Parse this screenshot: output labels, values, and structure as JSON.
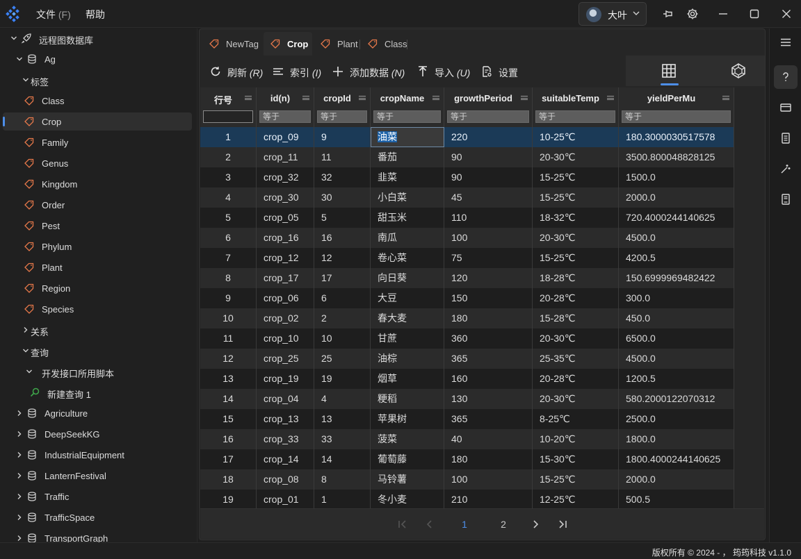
{
  "titlebar": {
    "menu": [
      {
        "label": "文件",
        "accel": "(F)"
      },
      {
        "label": "帮助",
        "accel": ""
      }
    ],
    "user": {
      "name": "大叶"
    }
  },
  "sidebar": {
    "items": [
      {
        "label": "远程图数据库",
        "icon": "rocket-icon",
        "chevron": "down",
        "level": 0
      },
      {
        "label": "Ag",
        "icon": "database-icon",
        "chevron": "down",
        "level": 1
      },
      {
        "label": "标签",
        "icon": "",
        "chevron": "down",
        "level": 2
      },
      {
        "label": "Class",
        "icon": "tag-icon",
        "chevron": "",
        "level": 3
      },
      {
        "label": "Crop",
        "icon": "tag-icon",
        "chevron": "",
        "level": 3,
        "selected": true
      },
      {
        "label": "Family",
        "icon": "tag-icon",
        "chevron": "",
        "level": 3
      },
      {
        "label": "Genus",
        "icon": "tag-icon",
        "chevron": "",
        "level": 3
      },
      {
        "label": "Kingdom",
        "icon": "tag-icon",
        "chevron": "",
        "level": 3
      },
      {
        "label": "Order",
        "icon": "tag-icon",
        "chevron": "",
        "level": 3
      },
      {
        "label": "Pest",
        "icon": "tag-icon",
        "chevron": "",
        "level": 3
      },
      {
        "label": "Phylum",
        "icon": "tag-icon",
        "chevron": "",
        "level": 3
      },
      {
        "label": "Plant",
        "icon": "tag-icon",
        "chevron": "",
        "level": 3
      },
      {
        "label": "Region",
        "icon": "tag-icon",
        "chevron": "",
        "level": 3
      },
      {
        "label": "Species",
        "icon": "tag-icon",
        "chevron": "",
        "level": 3
      },
      {
        "label": "关系",
        "icon": "",
        "chevron": "right",
        "level": 2
      },
      {
        "label": "查询",
        "icon": "",
        "chevron": "down",
        "level": 2
      },
      {
        "label": "开发接口所用脚本",
        "icon": "",
        "chevron": "down",
        "level": 3
      },
      {
        "label": "新建查询 1",
        "icon": "search-icon",
        "chevron": "",
        "level": 4
      },
      {
        "label": "Agriculture",
        "icon": "database-icon",
        "chevron": "right",
        "level": 1
      },
      {
        "label": "DeepSeekKG",
        "icon": "database-icon",
        "chevron": "right",
        "level": 1
      },
      {
        "label": "IndustrialEquipment",
        "icon": "database-icon",
        "chevron": "right",
        "level": 1
      },
      {
        "label": "LanternFestival",
        "icon": "database-icon",
        "chevron": "right",
        "level": 1
      },
      {
        "label": "Traffic",
        "icon": "database-icon",
        "chevron": "right",
        "level": 1
      },
      {
        "label": "TrafficSpace",
        "icon": "database-icon",
        "chevron": "right",
        "level": 1
      },
      {
        "label": "TransportGraph",
        "icon": "database-icon",
        "chevron": "right",
        "level": 1
      }
    ]
  },
  "tabs": [
    {
      "label": "NewTag",
      "active": false
    },
    {
      "label": "Crop",
      "active": true
    },
    {
      "label": "Plant",
      "active": false
    },
    {
      "label": "Class",
      "active": false
    }
  ],
  "toolbar": {
    "refresh": {
      "label": "刷新",
      "accel": "(R)"
    },
    "index": {
      "label": "索引",
      "accel": "(I)"
    },
    "add": {
      "label": "添加数据",
      "accel": "(N)"
    },
    "import": {
      "label": "导入",
      "accel": "(U)"
    },
    "settings": {
      "label": "设置"
    }
  },
  "table": {
    "columns": [
      "行号",
      "id(n)",
      "cropId",
      "cropName",
      "growthPeriod",
      "suitableTemp",
      "yieldPerMu"
    ],
    "filter_placeholder": "等于",
    "rows": [
      [
        "1",
        "crop_09",
        "9",
        "油菜",
        "220",
        "10-25℃",
        "180.3000030517578"
      ],
      [
        "2",
        "crop_11",
        "11",
        "番茄",
        "90",
        "20-30℃",
        "3500.800048828125"
      ],
      [
        "3",
        "crop_32",
        "32",
        "韭菜",
        "90",
        "15-25℃",
        "1500.0"
      ],
      [
        "4",
        "crop_30",
        "30",
        "小白菜",
        "45",
        "15-25℃",
        "2000.0"
      ],
      [
        "5",
        "crop_05",
        "5",
        "甜玉米",
        "110",
        "18-32℃",
        "720.4000244140625"
      ],
      [
        "6",
        "crop_16",
        "16",
        "南瓜",
        "100",
        "20-30℃",
        "4500.0"
      ],
      [
        "7",
        "crop_12",
        "12",
        "卷心菜",
        "75",
        "15-25℃",
        "4200.5"
      ],
      [
        "8",
        "crop_17",
        "17",
        "向日葵",
        "120",
        "18-28℃",
        "150.6999969482422"
      ],
      [
        "9",
        "crop_06",
        "6",
        "大豆",
        "150",
        "20-28℃",
        "300.0"
      ],
      [
        "10",
        "crop_02",
        "2",
        "春大麦",
        "180",
        "15-28℃",
        "450.0"
      ],
      [
        "11",
        "crop_10",
        "10",
        "甘蔗",
        "360",
        "20-30℃",
        "6500.0"
      ],
      [
        "12",
        "crop_25",
        "25",
        "油棕",
        "365",
        "25-35℃",
        "4500.0"
      ],
      [
        "13",
        "crop_19",
        "19",
        "烟草",
        "160",
        "20-28℃",
        "1200.5"
      ],
      [
        "14",
        "crop_04",
        "4",
        "粳稻",
        "130",
        "20-30℃",
        "580.2000122070312"
      ],
      [
        "15",
        "crop_13",
        "13",
        "苹果树",
        "365",
        "8-25℃",
        "2500.0"
      ],
      [
        "16",
        "crop_33",
        "33",
        "菠菜",
        "40",
        "10-20℃",
        "1800.0"
      ],
      [
        "17",
        "crop_14",
        "14",
        "葡萄藤",
        "180",
        "15-30℃",
        "1800.4000244140625"
      ],
      [
        "18",
        "crop_08",
        "8",
        "马铃薯",
        "100",
        "15-25℃",
        "2000.0"
      ],
      [
        "19",
        "crop_01",
        "1",
        "冬小麦",
        "210",
        "12-25℃",
        "500.5"
      ]
    ]
  },
  "pager": {
    "current": "1",
    "next": "2"
  },
  "statusbar": {
    "text": "版权所有 © 2024 - ，  筠筠科技   v1.1.0"
  },
  "colors": {
    "accent": "#4d8ee8",
    "tag": "#e8794a",
    "selected_row": "#1b3a57"
  }
}
